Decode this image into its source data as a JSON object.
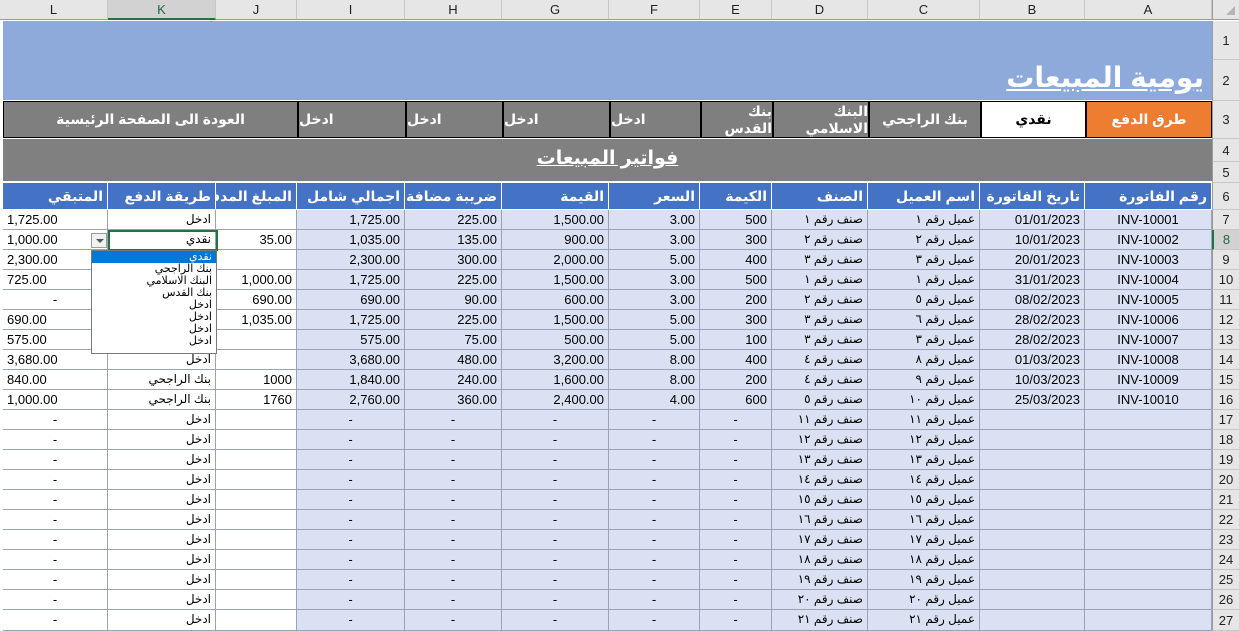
{
  "columns": [
    "L",
    "K",
    "J",
    "I",
    "H",
    "G",
    "F",
    "E",
    "D",
    "C",
    "B",
    "A"
  ],
  "rows": [
    "1",
    "2",
    "3",
    "4",
    "5",
    "6",
    "7",
    "8",
    "9",
    "10",
    "11",
    "12",
    "13",
    "14",
    "15",
    "16",
    "17",
    "18",
    "19",
    "20",
    "21",
    "22",
    "23",
    "24",
    "25",
    "26",
    "27"
  ],
  "title": "يومية المبيعات",
  "payment_bar": {
    "label": "طرق الدفع",
    "methods": [
      "نقدي",
      "بنك الراجحي",
      "البنك الاسلامي",
      "بنك القدس",
      "ادخل",
      "ادخل",
      "ادخل",
      "ادخل"
    ],
    "home_button": "العودة الى الصفحة الرئيسية"
  },
  "section_title": "فواتير المبيعات",
  "table": {
    "headers": [
      "رقم الفاتورة",
      "تاريخ الفاتورة",
      "اسم العميل",
      "الصنف",
      "الكيمة",
      "السعر",
      "القيمة",
      "ضريبة مضافة",
      "اجمالي شامل",
      "المبلغ المدفوع",
      "طريقة الدفع",
      "المتبقي"
    ],
    "rows": [
      [
        "INV-10001",
        "01/01/2023",
        "عميل رقم ١",
        "صنف رقم ١",
        "500",
        "3.00",
        "1,500.00",
        "225.00",
        "1,725.00",
        "",
        "ادخل",
        "1,725.00"
      ],
      [
        "INV-10002",
        "10/01/2023",
        "عميل رقم ٢",
        "صنف رقم ٢",
        "300",
        "3.00",
        "900.00",
        "135.00",
        "1,035.00",
        "35.00",
        "نقدي",
        "1,000.00"
      ],
      [
        "INV-10003",
        "20/01/2023",
        "عميل رقم ٣",
        "صنف رقم ٣",
        "400",
        "5.00",
        "2,000.00",
        "300.00",
        "2,300.00",
        "",
        "",
        "2,300.00"
      ],
      [
        "INV-10004",
        "31/01/2023",
        "عميل رقم ١",
        "صنف رقم ١",
        "500",
        "3.00",
        "1,500.00",
        "225.00",
        "1,725.00",
        "1,000.00",
        "",
        "725.00"
      ],
      [
        "INV-10005",
        "08/02/2023",
        "عميل رقم ٥",
        "صنف رقم ٢",
        "200",
        "3.00",
        "600.00",
        "90.00",
        "690.00",
        "690.00",
        "",
        "-"
      ],
      [
        "INV-10006",
        "28/02/2023",
        "عميل رقم ٦",
        "صنف رقم ٣",
        "300",
        "5.00",
        "1,500.00",
        "225.00",
        "1,725.00",
        "1,035.00",
        "",
        "690.00"
      ],
      [
        "INV-10007",
        "28/02/2023",
        "عميل رقم ٣",
        "صنف رقم ٣",
        "100",
        "5.00",
        "500.00",
        "75.00",
        "575.00",
        "",
        "",
        "575.00"
      ],
      [
        "INV-10008",
        "01/03/2023",
        "عميل رقم ٨",
        "صنف رقم ٤",
        "400",
        "8.00",
        "3,200.00",
        "480.00",
        "3,680.00",
        "",
        "ادخل",
        "3,680.00"
      ],
      [
        "INV-10009",
        "10/03/2023",
        "عميل رقم ٩",
        "صنف رقم ٤",
        "200",
        "8.00",
        "1,600.00",
        "240.00",
        "1,840.00",
        "1000",
        "بنك الراجحي",
        "840.00"
      ],
      [
        "INV-10010",
        "25/03/2023",
        "عميل رقم ١٠",
        "صنف رقم ٥",
        "600",
        "4.00",
        "2,400.00",
        "360.00",
        "2,760.00",
        "1760",
        "بنك الراجحي",
        "1,000.00"
      ],
      [
        "",
        "",
        "عميل رقم ١١",
        "صنف رقم ١١",
        "-",
        "-",
        "-",
        "-",
        "-",
        "",
        "ادخل",
        "-"
      ],
      [
        "",
        "",
        "عميل رقم ١٢",
        "صنف رقم ١٢",
        "-",
        "-",
        "-",
        "-",
        "-",
        "",
        "ادخل",
        "-"
      ],
      [
        "",
        "",
        "عميل رقم ١٣",
        "صنف رقم ١٣",
        "-",
        "-",
        "-",
        "-",
        "-",
        "",
        "ادخل",
        "-"
      ],
      [
        "",
        "",
        "عميل رقم ١٤",
        "صنف رقم ١٤",
        "-",
        "-",
        "-",
        "-",
        "-",
        "",
        "ادخل",
        "-"
      ],
      [
        "",
        "",
        "عميل رقم ١٥",
        "صنف رقم ١٥",
        "-",
        "-",
        "-",
        "-",
        "-",
        "",
        "ادخل",
        "-"
      ],
      [
        "",
        "",
        "عميل رقم ١٦",
        "صنف رقم ١٦",
        "-",
        "-",
        "-",
        "-",
        "-",
        "",
        "ادخل",
        "-"
      ],
      [
        "",
        "",
        "عميل رقم ١٧",
        "صنف رقم ١٧",
        "-",
        "-",
        "-",
        "-",
        "-",
        "",
        "ادخل",
        "-"
      ],
      [
        "",
        "",
        "عميل رقم ١٨",
        "صنف رقم ١٨",
        "-",
        "-",
        "-",
        "-",
        "-",
        "",
        "ادخل",
        "-"
      ],
      [
        "",
        "",
        "عميل رقم ١٩",
        "صنف رقم ١٩",
        "-",
        "-",
        "-",
        "-",
        "-",
        "",
        "ادخل",
        "-"
      ],
      [
        "",
        "",
        "عميل رقم ٢٠",
        "صنف رقم ٢٠",
        "-",
        "-",
        "-",
        "-",
        "-",
        "",
        "ادخل",
        "-"
      ],
      [
        "",
        "",
        "عميل رقم ٢١",
        "صنف رقم ٢١",
        "-",
        "-",
        "-",
        "-",
        "-",
        "",
        "ادخل",
        "-"
      ]
    ]
  },
  "dropdown": {
    "options": [
      "نقدي",
      "بنك الراجحي",
      "البنك الاسلامي",
      "بنك القدس",
      "ادخل",
      "ادخل",
      "ادخل",
      "ادخل"
    ],
    "highlighted": "نقدي"
  },
  "colors": {
    "banner": "#8eaadb",
    "header_blue": "#4472c4",
    "row_blue": "#d9e1f2",
    "orange": "#ed7d31",
    "gray": "#7f7f7f",
    "selection_green": "#217346"
  }
}
